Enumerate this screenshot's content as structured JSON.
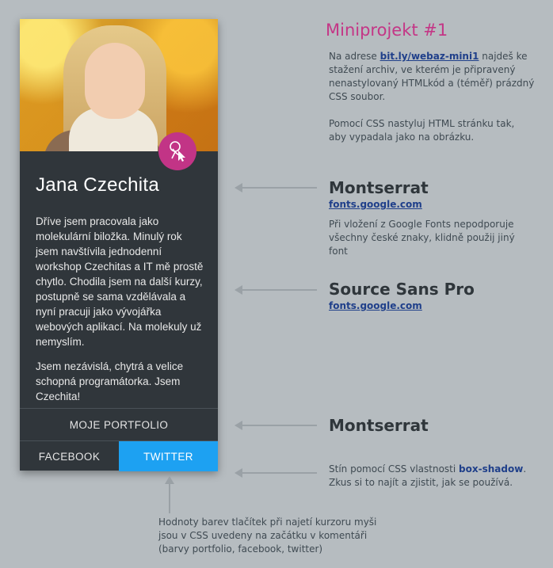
{
  "card": {
    "name": "Jana Czechita",
    "bio_paragraph_1": "Dříve jsem pracovala jako molekulární biložka. Minulý rok jsem navštívila jednodenní workshop Czechitas a IT mě prostě chytlo. Chodila jsem na další kurzy, postupně se sama vzdělávala a nyní pracuji jako vývojářka webových aplikací. Na molekuly už nemyslím.",
    "bio_paragraph_2": "Jsem nezávislá, chytrá a velice schopná programátorka. Jsem Czechita!",
    "portfolio_label": "MOJE PORTFOLIO",
    "facebook_label": "FACEBOOK",
    "twitter_label": "TWITTER",
    "badge_icon": "cursor-hand-icon",
    "colors": {
      "card_bg": "#30363b",
      "badge": "#c23486",
      "twitter": "#1da1f2"
    }
  },
  "annotations": {
    "title": "Miniprojekt #1",
    "intro_1_pre": "Na adrese ",
    "intro_1_link": "bit.ly/webaz-mini1",
    "intro_1_post": " najdeš ke stažení archiv, ve kterém je připravený nenastylovaný HTMLkód a (téměř) prázdný CSS soubor.",
    "intro_2": "Pomocí CSS nastyluj HTML stránku tak, aby vypadala jako na obrázku.",
    "font_heading_name": "Montserrat",
    "font_heading_link": "fonts.google.com",
    "font_heading_note": "Při vložení z Google Fonts nepodporuje všechny české znaky, klidně použij jiný font",
    "font_body_name": "Source Sans Pro",
    "font_body_link": "fonts.google.com",
    "font_buttons_name": "Montserrat",
    "shadow_pre": "Stín pomocí CSS vlastnosti ",
    "shadow_prop": "box-shadow",
    "shadow_post": ". Zkus si to najít a zjistit, jak se používá.",
    "hover_note": "Hodnoty barev tlačítek při najetí kurzoru myši jsou v CSS uvedeny na začátku v komentáři (barvy portfolio, facebook, twitter)"
  }
}
